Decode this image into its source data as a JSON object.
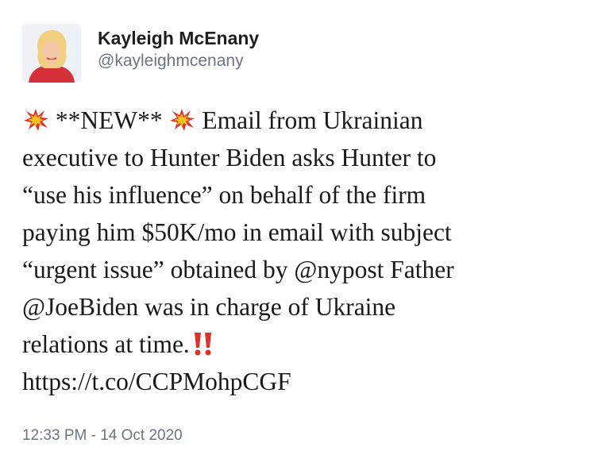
{
  "user": {
    "display_name": "Kayleigh McEnany",
    "handle": "@kayleighmcenany"
  },
  "tweet": {
    "emoji_before": "collision-emoji",
    "line1_tag": "**NEW**",
    "line1_rest": "Email from Ukrainian",
    "line2": "executive to Hunter Biden asks Hunter to",
    "line3": "“use his influence” on behalf of the firm",
    "line4": "paying him $50K/mo in email with subject",
    "line5": "“urgent issue” obtained by @nypost Father",
    "line6": "@JoeBiden was in charge of Ukraine",
    "line7": "relations at time.",
    "emoji_after": "double-exclamation-emoji",
    "link": "https://t.co/CCPMohpCGF"
  },
  "timestamp": "12:33 PM - 14 Oct 2020",
  "colors": {
    "name": "#1f1f1f",
    "secondary": "#6b7480",
    "emoji_red": "#e0302a",
    "emoji_yellow": "#f7c21b"
  }
}
